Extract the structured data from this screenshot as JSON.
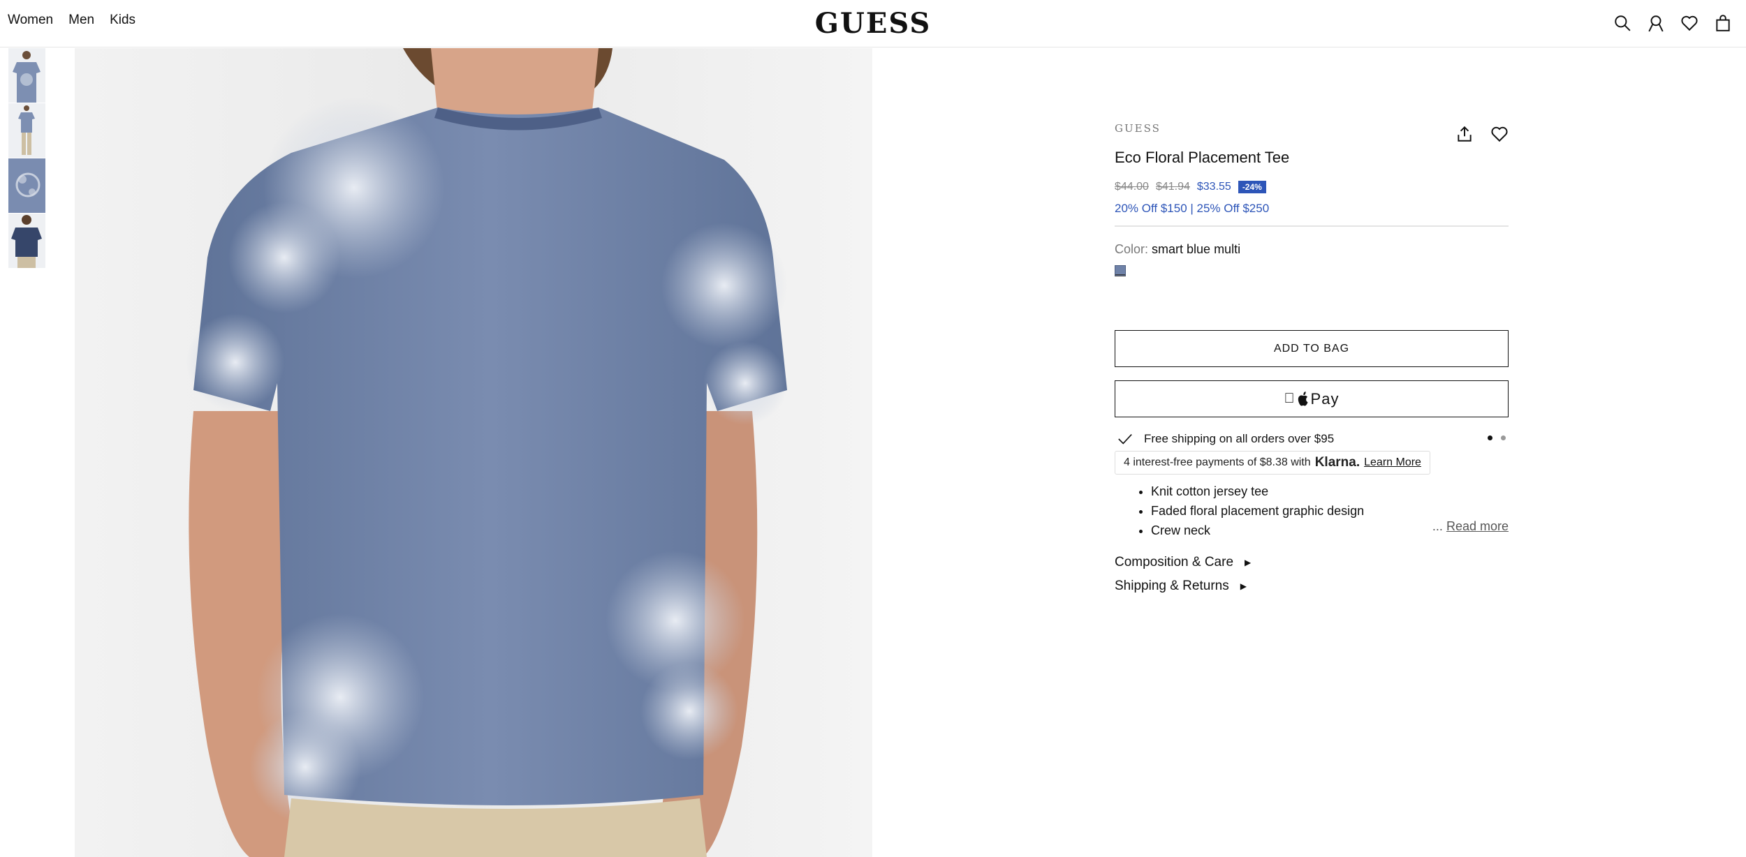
{
  "header": {
    "nav": [
      "Women",
      "Men",
      "Kids"
    ],
    "logo": "GUESS",
    "icons": [
      "search-icon",
      "account-icon",
      "wishlist-icon",
      "bag-icon"
    ]
  },
  "gallery": {
    "thumbnails": [
      "front-view",
      "full-body-view",
      "print-detail",
      "back-view"
    ],
    "main_image": "back-view"
  },
  "product": {
    "brand": "GUESS",
    "title": "Eco Floral Placement Tee",
    "price_original": "$44.00",
    "price_previous": "$41.94",
    "price_current": "$33.55",
    "discount_badge": "-24%",
    "promo": "20% Off $150 | 25% Off $250",
    "color_label": "Color:",
    "color_value": "smart blue multi",
    "swatch_color": "#6f82a8",
    "add_to_bag": "ADD TO BAG",
    "apple_pay": "Pay",
    "shipping": "Free shipping on all orders over $95",
    "klarna_text": "4 interest-free payments of $8.38 with",
    "klarna_brand": "Klarna.",
    "klarna_link": "Learn More",
    "features": [
      "Knit cotton jersey tee",
      "Faded floral placement graphic design",
      "Crew neck"
    ],
    "read_more_ellipsis": "...",
    "read_more": "Read more",
    "accordions": [
      "Composition & Care",
      "Shipping & Returns"
    ]
  },
  "colors": {
    "accent": "#2d55b8",
    "shirt": "#7385a8"
  }
}
